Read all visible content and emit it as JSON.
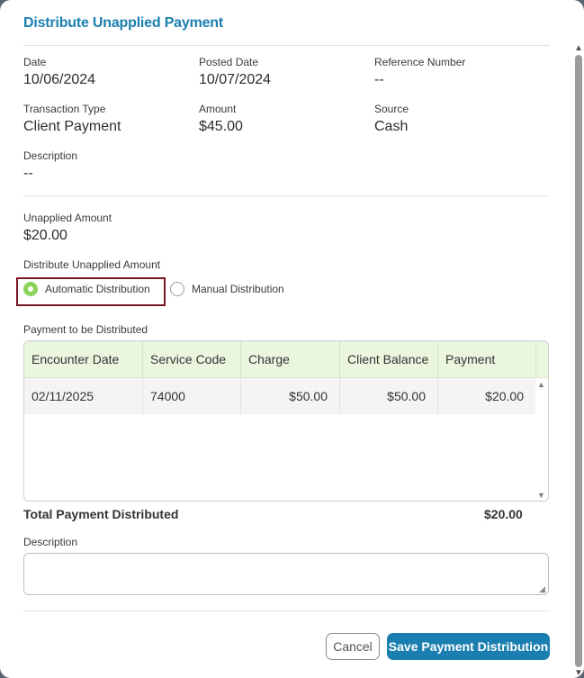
{
  "dialog": {
    "title": "Distribute Unapplied Payment"
  },
  "details": {
    "date": {
      "label": "Date",
      "value": "10/06/2024"
    },
    "posted_date": {
      "label": "Posted Date",
      "value": "10/07/2024"
    },
    "reference_number": {
      "label": "Reference Number",
      "value": "--"
    },
    "transaction_type": {
      "label": "Transaction Type",
      "value": "Client Payment"
    },
    "amount": {
      "label": "Amount",
      "value": "$45.00"
    },
    "source": {
      "label": "Source",
      "value": "Cash"
    },
    "description": {
      "label": "Description",
      "value": "--"
    }
  },
  "unapplied": {
    "label": "Unapplied Amount",
    "value": "$20.00"
  },
  "distribution": {
    "label": "Distribute Unapplied Amount",
    "options": [
      {
        "label": "Automatic Distribution",
        "selected": true
      },
      {
        "label": "Manual Distribution",
        "selected": false
      }
    ]
  },
  "payment_grid": {
    "label": "Payment to be Distributed",
    "columns": [
      "Encounter Date",
      "Service Code",
      "Charge",
      "Client Balance",
      "Payment"
    ],
    "rows": [
      {
        "encounter_date": "02/11/2025",
        "service_code": "74000",
        "charge": "$50.00",
        "client_balance": "$50.00",
        "payment": "$20.00"
      }
    ]
  },
  "total": {
    "label": "Total Payment Distributed",
    "value": "$20.00"
  },
  "description_field": {
    "label": "Description",
    "value": ""
  },
  "buttons": {
    "cancel": "Cancel",
    "save": "Save Payment Distribution"
  },
  "colors": {
    "accent": "#1a7fb0",
    "header_bg": "#eaf6de",
    "radio_selected": "#8bd35a",
    "highlight_border": "#7a1526"
  }
}
